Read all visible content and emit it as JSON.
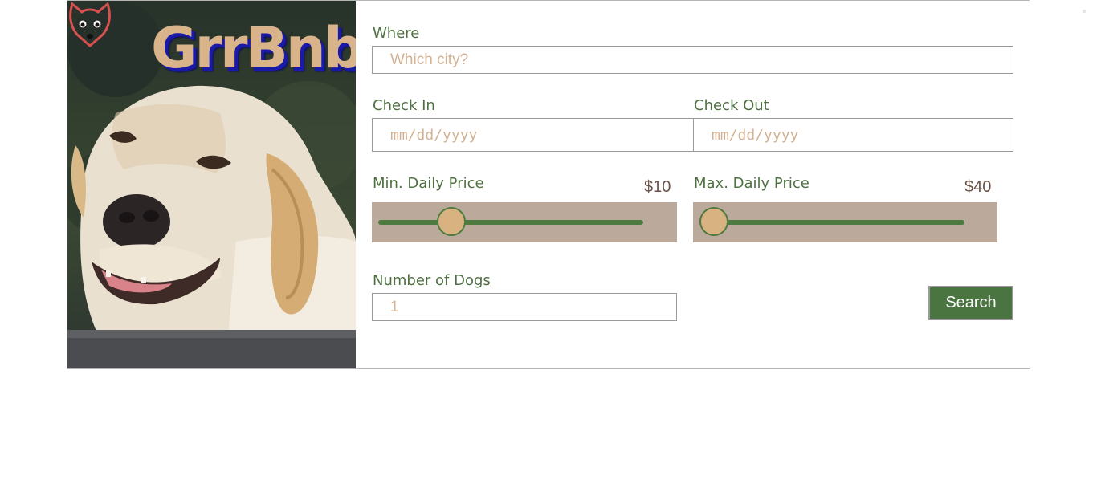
{
  "brand": {
    "name": "GrrBnb",
    "logo_icon": "fox-heart-logo-icon",
    "accent_color": "#d9b38a"
  },
  "hero": {
    "image": "smiling-labrador-dog-photo"
  },
  "form": {
    "where": {
      "label": "Where",
      "placeholder": "Which city?"
    },
    "check_in": {
      "label": "Check In",
      "placeholder": "mm/dd/yyyy"
    },
    "check_out": {
      "label": "Check Out",
      "placeholder": "mm/dd/yyyy"
    },
    "min_price": {
      "label": "Min. Daily Price",
      "value_text": "$10",
      "slider_position": 0.25
    },
    "max_price": {
      "label": "Max. Daily Price",
      "value_text": "$40",
      "slider_position": 0.0
    },
    "dogs": {
      "label": "Number of Dogs",
      "placeholder": "1"
    },
    "search_label": "Search"
  },
  "colors": {
    "label_green": "#4f7141",
    "button_green": "#4a7540",
    "slider_bg": "#bba99b",
    "thumb": "#d9b282",
    "placeholder": "#d3b294"
  }
}
